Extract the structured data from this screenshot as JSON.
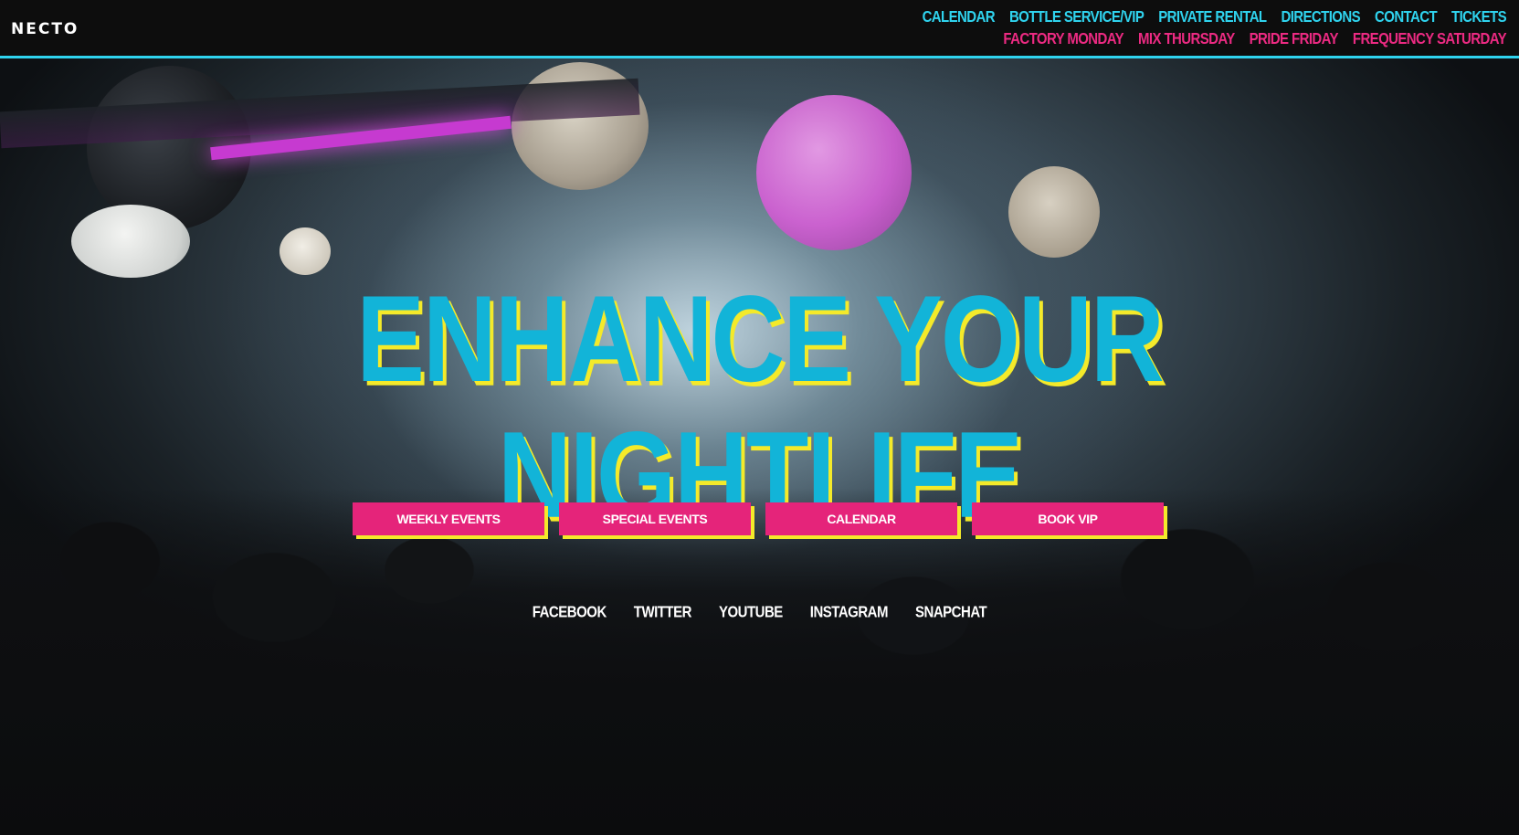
{
  "header": {
    "logo_text": "NECTO",
    "nav_primary": [
      {
        "label": "CALENDAR"
      },
      {
        "label": "BOTTLE SERVICE/VIP"
      },
      {
        "label": "PRIVATE RENTAL"
      },
      {
        "label": "DIRECTIONS"
      },
      {
        "label": "CONTACT"
      },
      {
        "label": "TICKETS"
      }
    ],
    "nav_secondary": [
      {
        "label": "FACTORY MONDAY"
      },
      {
        "label": "MIX THURSDAY"
      },
      {
        "label": "PRIDE FRIDAY"
      },
      {
        "label": "FREQUENCY SATURDAY"
      }
    ]
  },
  "hero": {
    "headline_line1": "ENHANCE YOUR",
    "headline_line2": "NIGHTLIFE",
    "buttons": [
      {
        "label": "WEEKLY EVENTS"
      },
      {
        "label": "SPECIAL EVENTS"
      },
      {
        "label": "CALENDAR"
      },
      {
        "label": "BOOK VIP"
      }
    ],
    "social": [
      {
        "label": "FACEBOOK"
      },
      {
        "label": "TWITTER"
      },
      {
        "label": "YOUTUBE"
      },
      {
        "label": "INSTAGRAM"
      },
      {
        "label": "SNAPCHAT"
      }
    ]
  },
  "colors": {
    "accent_cyan": "#2fd3ee",
    "headline_blue": "#12b4d8",
    "accent_pink": "#e5247a",
    "accent_yellow": "#f4ea2a",
    "header_bg": "#0d0d0d"
  }
}
